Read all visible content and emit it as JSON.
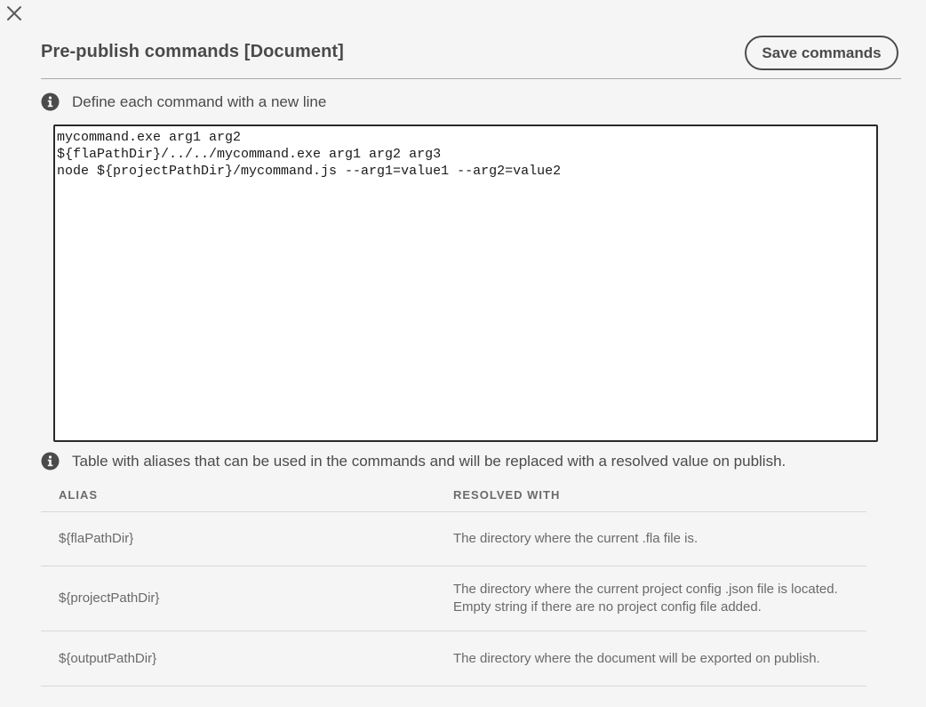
{
  "dialog": {
    "close_glyph": "✕",
    "title": "Pre-publish commands [Document]",
    "save_label": "Save commands"
  },
  "info": {
    "define_hint": "Define each command with a new line",
    "alias_hint": "Table with aliases that can be used in the commands and will be replaced with a resolved value on publish."
  },
  "editor": {
    "value": "mycommand.exe arg1 arg2\n${flaPathDir}/../../mycommand.exe arg1 arg2 arg3\nnode ${projectPathDir}/mycommand.js --arg1=value1 --arg2=value2"
  },
  "table": {
    "headers": {
      "alias": "ALIAS",
      "resolved": "RESOLVED WITH"
    },
    "rows": [
      {
        "alias": "${flaPathDir}",
        "resolved": "The directory where the current .fla file is."
      },
      {
        "alias": "${projectPathDir}",
        "resolved": "The directory where the current project config .json file is located. Empty string if there are no project config file added."
      },
      {
        "alias": "${outputPathDir}",
        "resolved": "The directory where the document will be exported on publish."
      }
    ]
  },
  "icons": {
    "close": "close-icon",
    "info": "info-icon"
  },
  "colors": {
    "background": "#f5f5f5",
    "text": "#4b4b4b",
    "editor_border": "#2a2a2a",
    "divider": "#d8d8d8"
  }
}
